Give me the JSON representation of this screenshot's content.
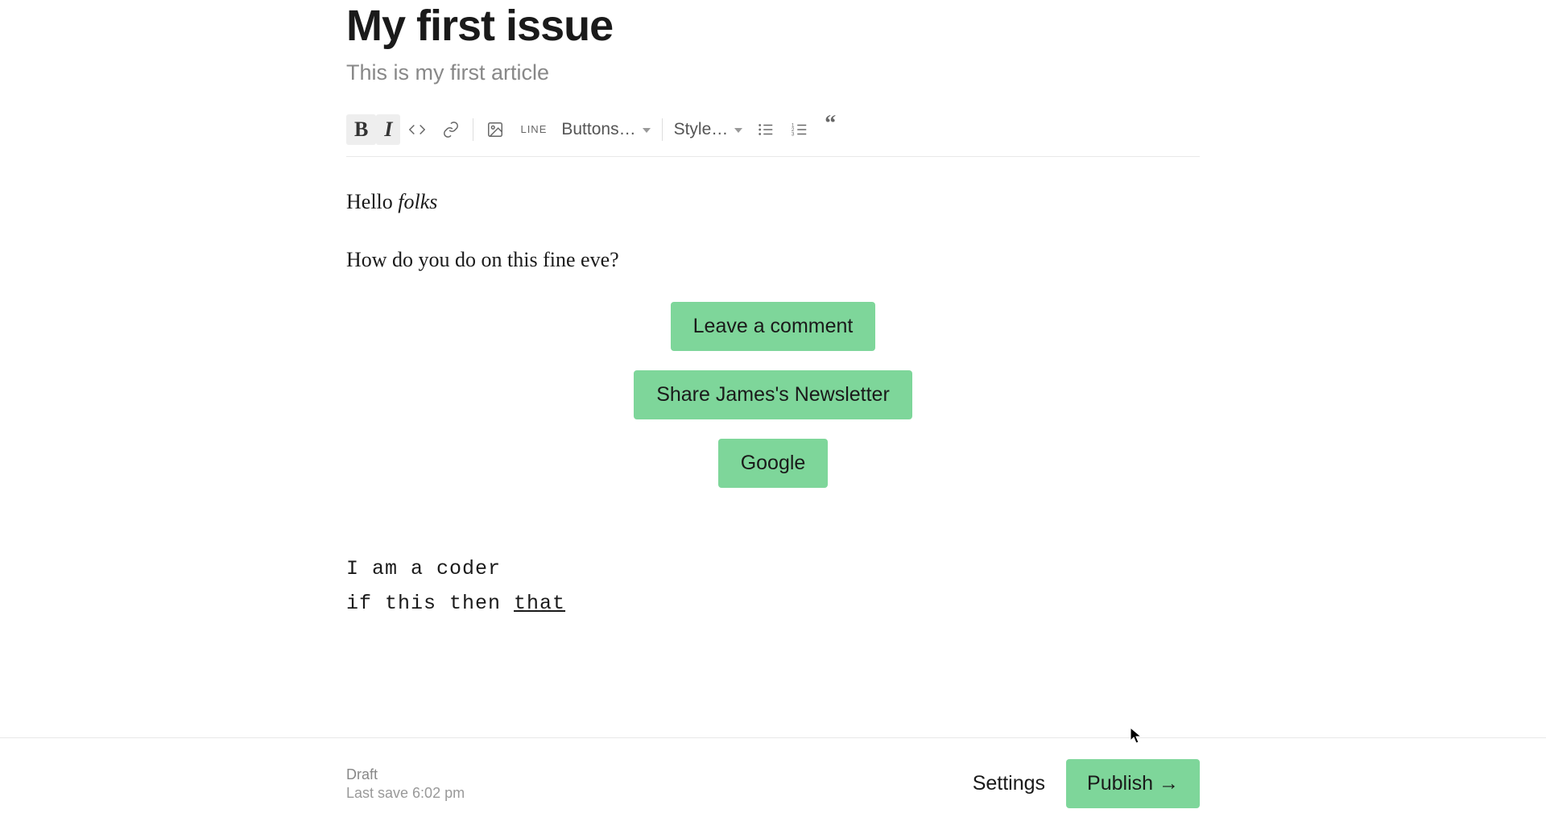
{
  "header": {
    "title": "My first issue",
    "subtitle": "This is my first article"
  },
  "toolbar": {
    "buttons_label": "Buttons…",
    "style_label": "Style…",
    "line_label": "LINE"
  },
  "content": {
    "p1_plain": "Hello ",
    "p1_italic": "folks",
    "p2": "How do you do on this fine eve?",
    "code_line1": "I am a coder",
    "code_line2_prefix": "if this then ",
    "code_line2_link": "that"
  },
  "buttons": {
    "comment": "Leave a comment",
    "share": "Share James's Newsletter",
    "google": "Google"
  },
  "footer": {
    "draft": "Draft",
    "last_save": "Last save 6:02 pm",
    "settings": "Settings",
    "publish": "Publish →"
  }
}
